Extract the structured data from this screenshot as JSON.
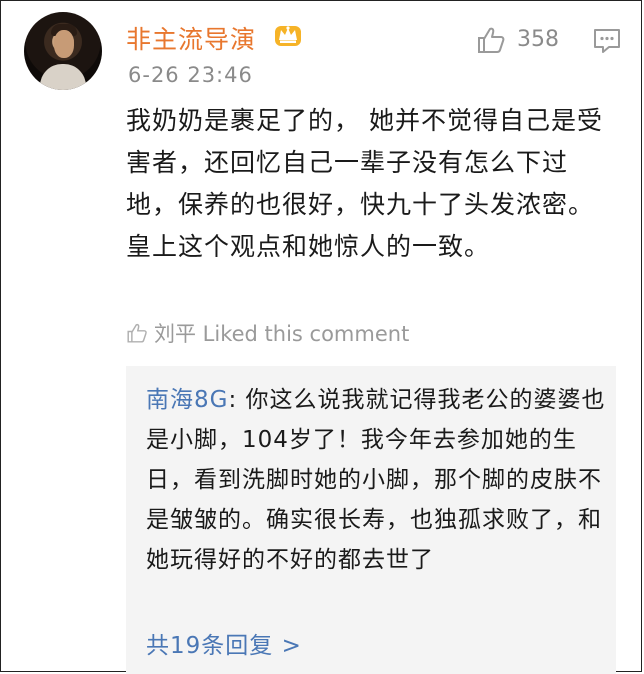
{
  "comment": {
    "username": "非主流导演",
    "badge_icon": "crown-icon",
    "date": "6-26 23:46",
    "like_count": "358",
    "text": "我奶奶是裹足了的， 她并不觉得自己是受害者，还回忆自己一辈子没有怎么下过地，保养的也很好，快九十了头发浓密。皇上这个观点和她惊人的一致。",
    "liked_by": "刘平 Liked this comment"
  },
  "reply": {
    "user": "南海8G",
    "text": ": 你这么说我就记得我老公的婆婆也是小脚，104岁了！我今年去参加她的生日，看到洗脚时她的小脚，那个脚的皮肤不是皱皱的。确实很长寿，也独孤求败了，和她玩得好的不好的都去世了",
    "more_label": "共19条回复 >"
  },
  "colors": {
    "username": "#e8772e",
    "link": "#4a77b5",
    "meta": "#8a8a8a",
    "reply_bg": "#f4f4f4"
  }
}
